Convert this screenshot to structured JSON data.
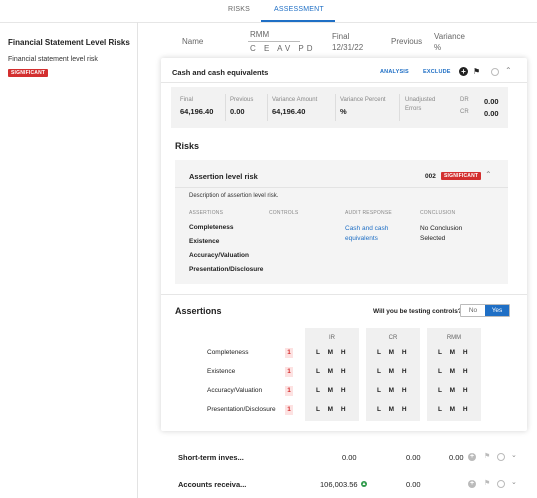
{
  "tabs": [
    {
      "label": "RISKS",
      "active": false
    },
    {
      "label": "ASSESSMENT",
      "active": true
    }
  ],
  "left_panel": {
    "title": "Financial Statement Level Risks",
    "risk_name": "Financial statement level risk",
    "badge": "SIGNIFICANT"
  },
  "table_header": {
    "name": "Name",
    "rmm": "RMM",
    "rmm_sub": "C E AV PD",
    "final_line1": "Final",
    "final_line2": "12/31/22",
    "previous": "Previous",
    "variance_line1": "Variance",
    "variance_line2": "%"
  },
  "card": {
    "title": "Cash and cash equivalents",
    "analysis_label": "ANALYSIS",
    "exclude_label": "EXCLUDE",
    "summary": {
      "final_label": "Final",
      "final_value": "64,196.40",
      "previous_label": "Previous",
      "previous_value": "0.00",
      "variance_amount_label": "Variance Amount",
      "variance_amount_value": "64,196.40",
      "variance_percent_label": "Variance Percent",
      "variance_percent_value": "%",
      "unadjusted_label_1": "Unadjusted",
      "unadjusted_label_2": "Errors",
      "dr_label": "DR",
      "dr_value": "0.00",
      "cr_label": "CR",
      "cr_value": "0.00"
    },
    "risks": {
      "section_title": "Risks",
      "risk_title": "Assertion level risk",
      "risk_number": "002",
      "risk_badge": "SIGNIFICANT",
      "description": "Description of assertion level risk.",
      "col_assertions": "ASSERTIONS",
      "col_controls": "CONTROLS",
      "col_audit_response": "AUDIT RESPONSE",
      "col_conclusion": "CONCLUSION",
      "assertions": [
        "Completeness",
        "Existence",
        "Accuracy/Valuation",
        "Presentation/Disclosure"
      ],
      "audit_response_line1": "Cash and cash",
      "audit_response_line2": "equivalents",
      "conclusion_line1": "No Conclusion",
      "conclusion_line2": "Selected"
    },
    "assertions_section": {
      "title": "Assertions",
      "testing_question": "Will you be testing controls?",
      "toggle_no": "No",
      "toggle_yes": "Yes",
      "toggle_selected": "Yes",
      "groups": [
        "IR",
        "CR",
        "RMM"
      ],
      "lmh": "L M H",
      "rows": [
        {
          "name": "Completeness",
          "count": "1"
        },
        {
          "name": "Existence",
          "count": "1"
        },
        {
          "name": "Accuracy/Valuation",
          "count": "1"
        },
        {
          "name": "Presentation/Disclosure",
          "count": "1"
        }
      ]
    }
  },
  "bottom_rows": [
    {
      "name": "Short-term inves...",
      "final": "0.00",
      "previous": "0.00",
      "variance": "0.00"
    },
    {
      "name": "Accounts receiva...",
      "final": "106,003.56",
      "previous": "0.00",
      "variance": ""
    }
  ],
  "colors": {
    "accent": "#1f6fc5",
    "significant": "#d32f2f"
  }
}
